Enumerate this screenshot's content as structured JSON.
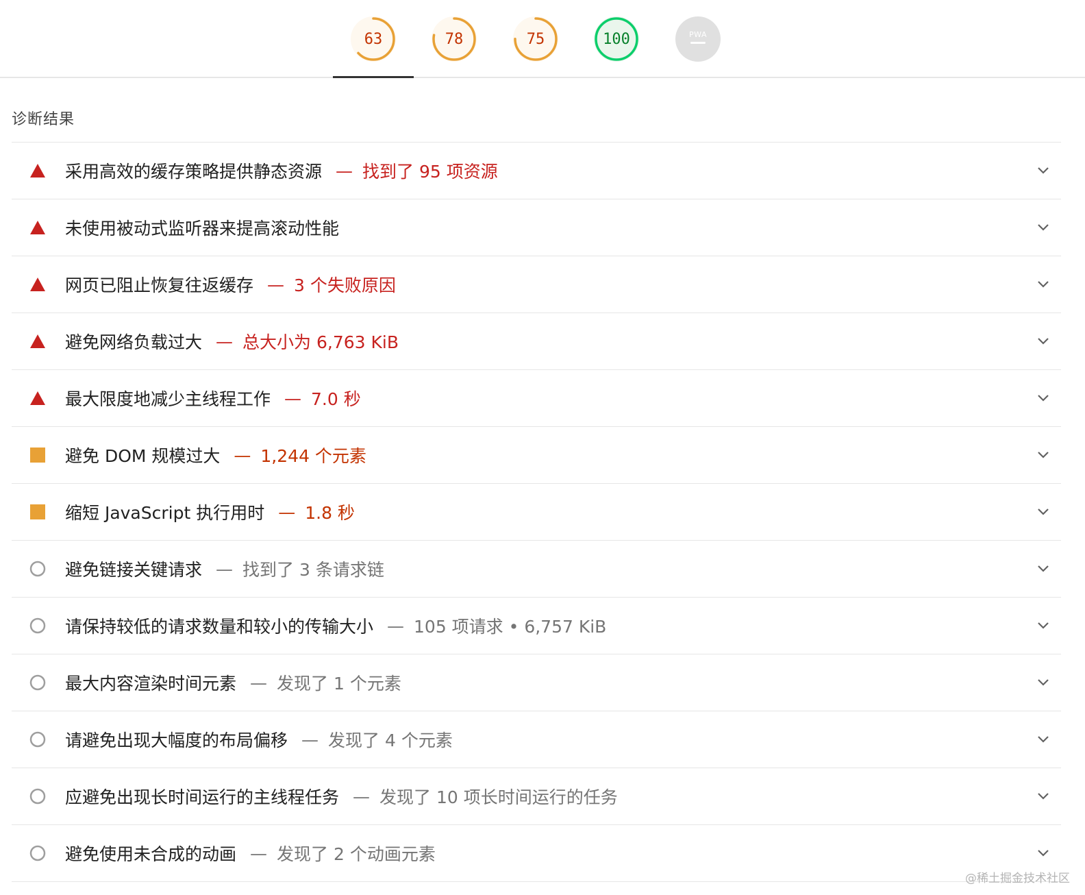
{
  "scores": [
    {
      "value": "63",
      "status": "average",
      "ratio": 0.63
    },
    {
      "value": "78",
      "status": "average",
      "ratio": 0.78
    },
    {
      "value": "75",
      "status": "average",
      "ratio": 0.75
    },
    {
      "value": "100",
      "status": "pass",
      "ratio": 1.0
    },
    {
      "value": "PWA",
      "status": "na",
      "ratio": 0
    }
  ],
  "colors": {
    "fail": "#c7221f",
    "average": "#e8a136",
    "average_text": "#c33300",
    "pass": "#0cce6b",
    "pass_text": "#08802b",
    "info": "#9e9e9e"
  },
  "diagnostics": {
    "title": "诊断结果",
    "items": [
      {
        "status": "fail",
        "icon": "red-triangle-icon",
        "title": "采用高效的缓存策略提供静态资源",
        "display": "找到了 95 项资源"
      },
      {
        "status": "fail",
        "icon": "red-triangle-icon",
        "title": "未使用被动式监听器来提高滚动性能",
        "display": ""
      },
      {
        "status": "fail",
        "icon": "red-triangle-icon",
        "title": "网页已阻止恢复往返缓存",
        "display": "3 个失败原因"
      },
      {
        "status": "fail",
        "icon": "red-triangle-icon",
        "title": "避免网络负载过大",
        "display": "总大小为 6,763 KiB"
      },
      {
        "status": "fail",
        "icon": "red-triangle-icon",
        "title": "最大限度地减少主线程工作",
        "display": "7.0 秒"
      },
      {
        "status": "average",
        "icon": "orange-square-icon",
        "title": "避免 DOM 规模过大",
        "display": "1,244 个元素"
      },
      {
        "status": "average",
        "icon": "orange-square-icon",
        "title": "缩短 JavaScript 执行用时",
        "display": "1.8 秒"
      },
      {
        "status": "info",
        "icon": "gray-circle-icon",
        "title": "避免链接关键请求",
        "display": "找到了 3 条请求链"
      },
      {
        "status": "info",
        "icon": "gray-circle-icon",
        "title": "请保持较低的请求数量和较小的传输大小",
        "display": "105 项请求 • 6,757 KiB"
      },
      {
        "status": "info",
        "icon": "gray-circle-icon",
        "title": "最大内容渲染时间元素",
        "display": "发现了 1 个元素"
      },
      {
        "status": "info",
        "icon": "gray-circle-icon",
        "title": "请避免出现大幅度的布局偏移",
        "display": "发现了 4 个元素"
      },
      {
        "status": "info",
        "icon": "gray-circle-icon",
        "title": "应避免出现长时间运行的主线程任务",
        "display": "发现了 10 项长时间运行的任务"
      },
      {
        "status": "info",
        "icon": "gray-circle-icon",
        "title": "避免使用未合成的动画",
        "display": "发现了 2 个动画元素"
      }
    ]
  },
  "separator": "—",
  "watermark": "@稀土掘金技术社区"
}
